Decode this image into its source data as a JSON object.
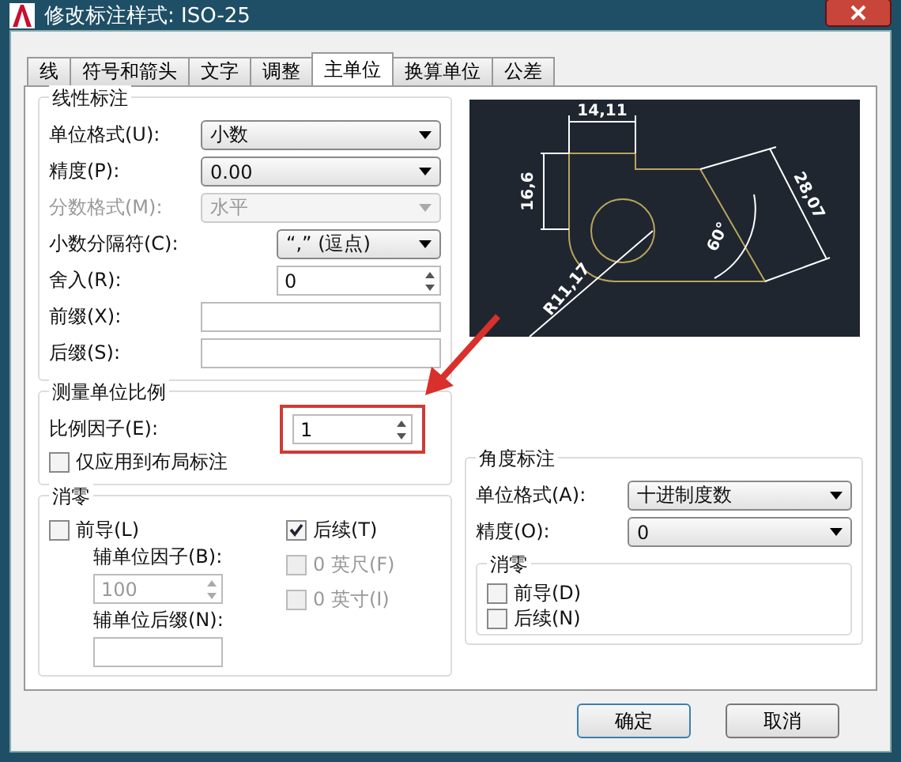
{
  "window": {
    "title": "修改标注样式: ISO-25"
  },
  "tabs": [
    {
      "label": "线",
      "selected": false
    },
    {
      "label": "符号和箭头",
      "selected": false
    },
    {
      "label": "文字",
      "selected": false
    },
    {
      "label": "调整",
      "selected": false
    },
    {
      "label": "主单位",
      "selected": true
    },
    {
      "label": "换算单位",
      "selected": false
    },
    {
      "label": "公差",
      "selected": false
    }
  ],
  "linear": {
    "title": "线性标注",
    "fields": [
      {
        "kind": "select",
        "label": "单位格式(U):",
        "value": "小数",
        "disabled": false,
        "wide": true
      },
      {
        "kind": "select",
        "label": "精度(P):",
        "value": "0.00",
        "disabled": false,
        "wide": true
      },
      {
        "kind": "select",
        "label": "分数格式(M):",
        "value": "水平",
        "disabled": true,
        "wide": true
      },
      {
        "kind": "select",
        "label": "小数分隔符(C):",
        "value": "“,” (逗点)",
        "disabled": false,
        "wide": false
      },
      {
        "kind": "spin",
        "label": "舍入(R):",
        "value": "0",
        "disabled": false,
        "wide": false
      },
      {
        "kind": "text",
        "label": "前缀(X):",
        "disabled": false,
        "wide": true
      },
      {
        "kind": "text",
        "label": "后缀(S):",
        "disabled": false,
        "wide": true
      }
    ]
  },
  "scale": {
    "title": "测量单位比例",
    "factor_label": "比例因子(E):",
    "factor_value": "1",
    "highlighted": true,
    "layout_only": {
      "label": "仅应用到布局标注",
      "checked": false
    }
  },
  "zero": {
    "title": "消零",
    "leading": {
      "label": "前导(L)",
      "checked": false
    },
    "sub_factor_label": "辅单位因子(B):",
    "sub_factor_value": "100",
    "sub_suffix_label": "辅单位后缀(N):",
    "right": [
      {
        "label": "后续(T)",
        "checked": true,
        "disabled": false
      },
      {
        "label": "0 英尺(F)",
        "checked": false,
        "disabled": true
      },
      {
        "label": "0 英寸(I)",
        "checked": false,
        "disabled": true
      }
    ]
  },
  "preview": {
    "labels": [
      "14,11",
      "16,6",
      "28,07",
      "60°",
      "R11,17"
    ]
  },
  "angular": {
    "title": "角度标注",
    "fields": [
      {
        "label": "单位格式(A):",
        "value": "十进制度数"
      },
      {
        "label": "精度(O):",
        "value": "0"
      }
    ],
    "zero": {
      "title": "消零",
      "items": [
        {
          "label": "前导(D)",
          "checked": false
        },
        {
          "label": "后续(N)",
          "checked": false
        }
      ]
    }
  },
  "buttons": [
    "确定",
    "取消"
  ]
}
